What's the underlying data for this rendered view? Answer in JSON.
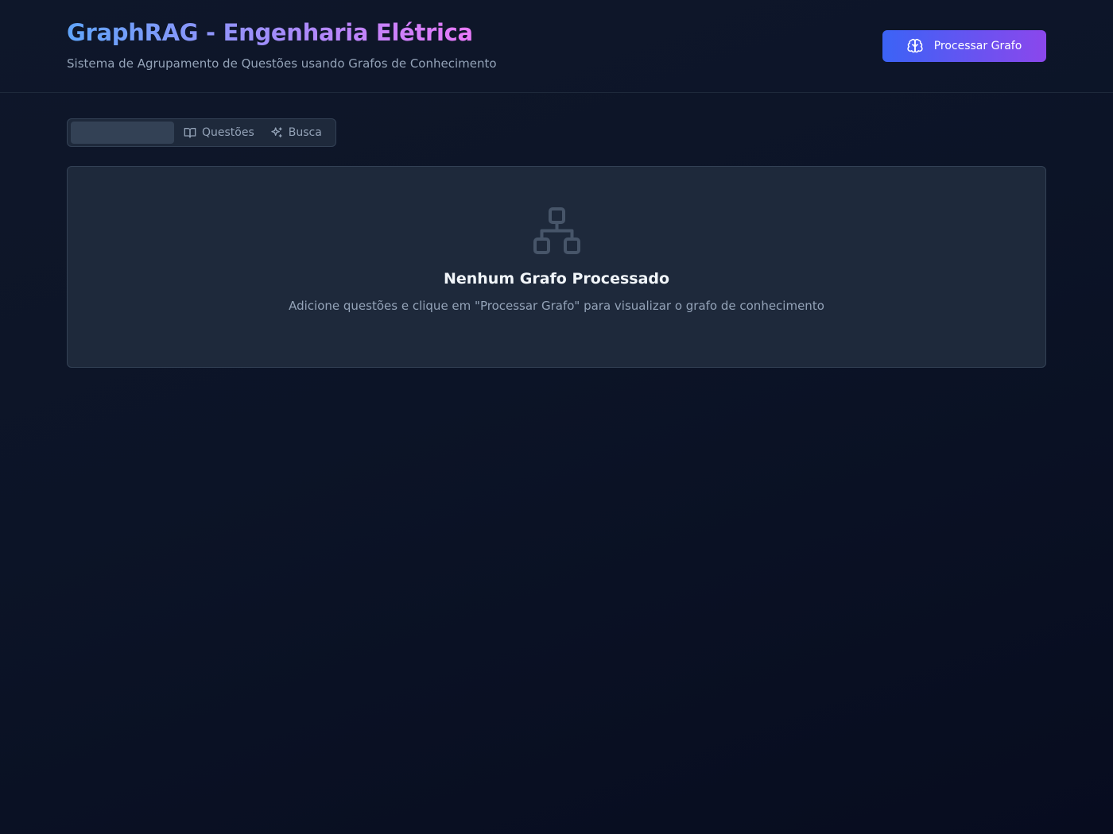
{
  "header": {
    "title": "GraphRAG - Engenharia Elétrica",
    "subtitle": "Sistema de Agrupamento de Questões usando Grafos de Conhecimento",
    "process_button": {
      "label": "Processar Grafo",
      "icon": "brain-icon"
    }
  },
  "tabs": [
    {
      "label": "",
      "active": true
    },
    {
      "label": "Questões",
      "icon": "book-open-icon",
      "active": false
    },
    {
      "label": "Busca",
      "icon": "sparkles-icon",
      "active": false
    }
  ],
  "empty_state": {
    "icon": "network-icon",
    "title": "Nenhum Grafo Processado",
    "description": "Adicione questões e clique em \"Processar Grafo\" para visualizar o grafo de conhecimento"
  },
  "colors": {
    "background": "#0f172a",
    "panel": "#1e293b",
    "border": "#334155",
    "accent_blue": "#3b63f6",
    "accent_purple": "#8b47ec",
    "muted_text": "#94a3b8"
  }
}
